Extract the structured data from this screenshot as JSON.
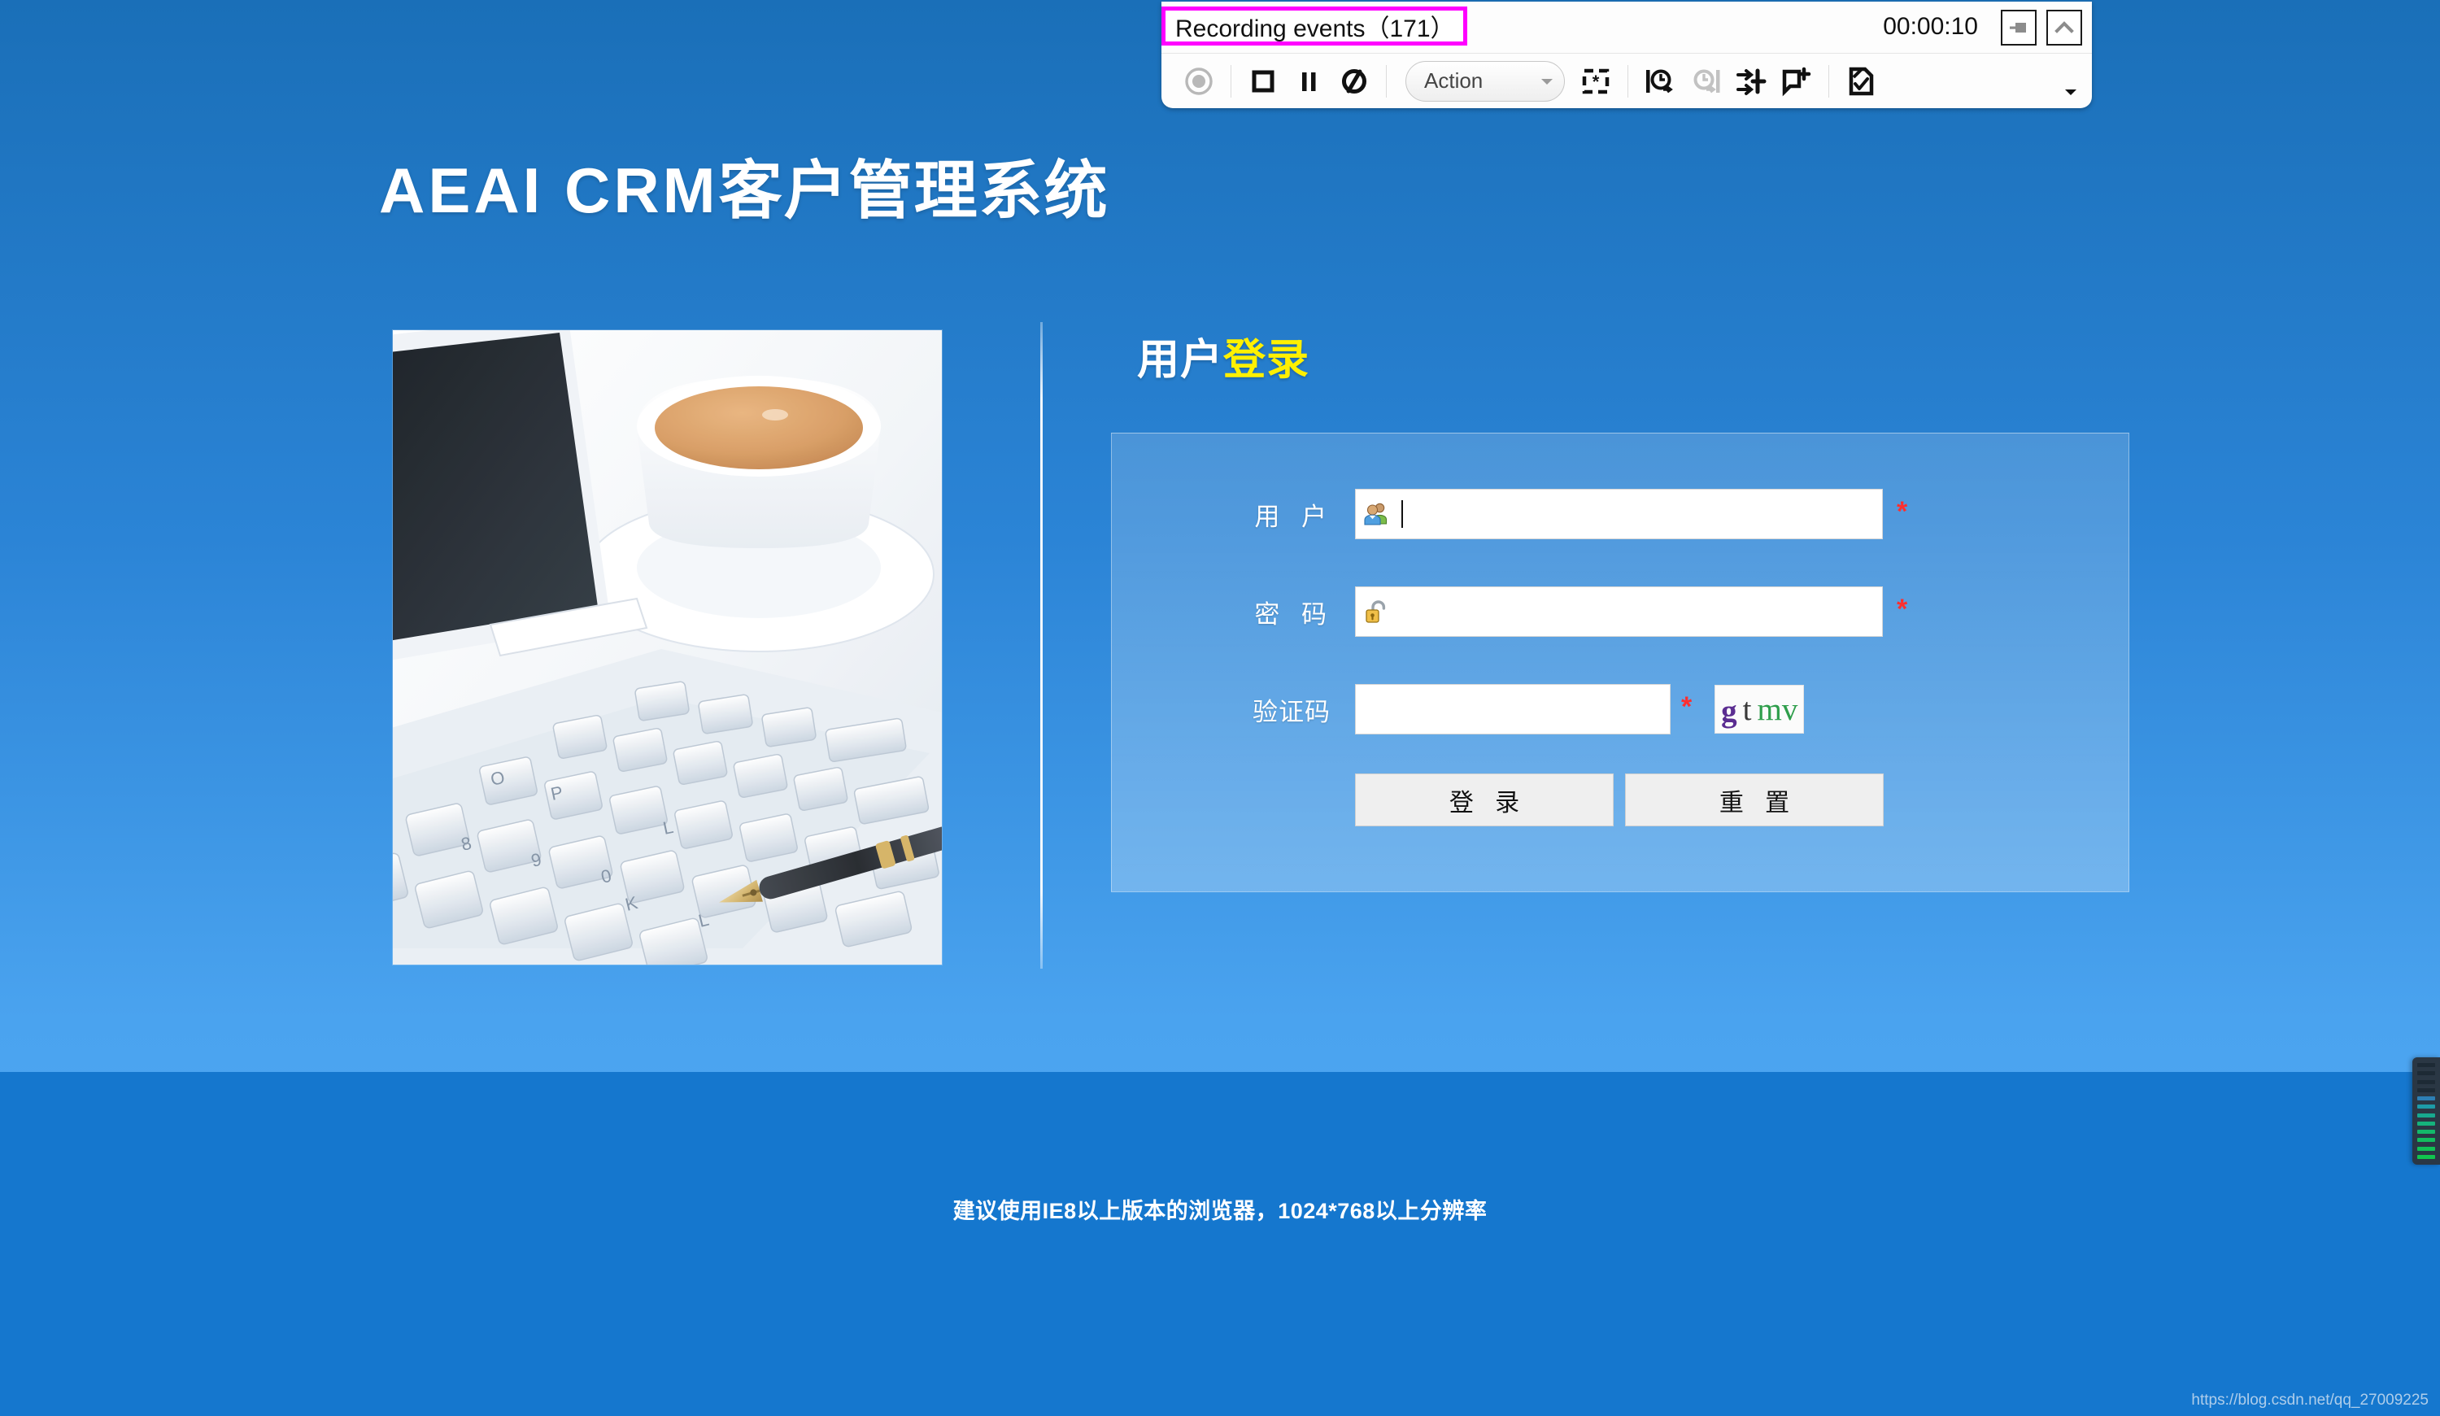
{
  "brand": {
    "latin": "AEAI CRM",
    "cjk": "客户管理系统"
  },
  "login": {
    "heading_white": "用户",
    "heading_yellow": "登录",
    "fields": [
      {
        "label": "用 户",
        "value": "",
        "required_mark": "*",
        "icon": "users-icon"
      },
      {
        "label": "密 码",
        "value": "",
        "required_mark": "*",
        "icon": "unlock-icon"
      },
      {
        "label": "验证码",
        "value": "",
        "required_mark": "*",
        "icon": "captcha-icon"
      }
    ],
    "captcha": {
      "text": "g t mv",
      "char1": "g",
      "char2": "t",
      "char3": "mv",
      "color1": "#5b2d91",
      "color2": "#3a3a3a",
      "color3": "#2e9e4b"
    },
    "buttons": {
      "submit": "登 录",
      "reset": "重 置"
    }
  },
  "footer": {
    "note": "建议使用IE8以上版本的浏览器，1024*768以上分辨率",
    "watermark": "https://blog.csdn.net/qq_27009225"
  },
  "recorder": {
    "status": "Recording events（171）",
    "timer": "00:00:10",
    "highlight_color": "#ff00ff",
    "action_combo": "Action",
    "toolbar_buttons": [
      {
        "name": "record-button",
        "state": "disabled"
      },
      {
        "name": "stop-button",
        "state": "enabled"
      },
      {
        "name": "pause-button",
        "state": "enabled"
      },
      {
        "name": "no-recording-button",
        "state": "enabled"
      },
      {
        "name": "insert-step-button",
        "state": "enabled"
      },
      {
        "name": "insert-checkpoint-start-button",
        "state": "enabled"
      },
      {
        "name": "insert-checkpoint-end-button",
        "state": "disabled"
      },
      {
        "name": "insert-output-value-button",
        "state": "enabled"
      },
      {
        "name": "insert-comment-button",
        "state": "enabled"
      },
      {
        "name": "insert-verify-button",
        "state": "enabled"
      }
    ],
    "window_buttons": [
      {
        "name": "dock-button"
      },
      {
        "name": "collapse-button"
      }
    ],
    "more_label": "▾"
  },
  "theme": {
    "bg_top": "#1a6fb8",
    "bg_bottom": "#55aaf5",
    "footer_band": "#1577ce",
    "accent_yellow": "#fff000",
    "required_red": "#ff2f2f"
  }
}
